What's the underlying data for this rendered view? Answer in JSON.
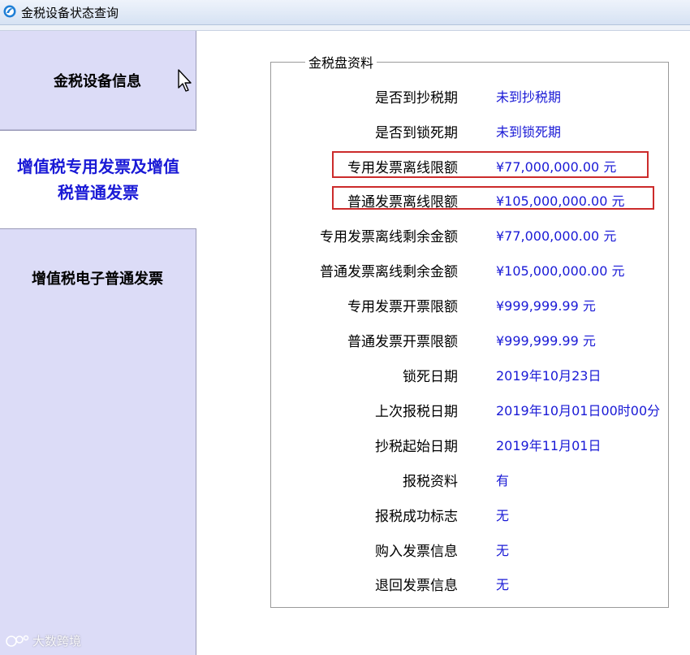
{
  "window": {
    "title": "金税设备状态查询"
  },
  "sidebar": {
    "tabs": [
      {
        "label": "金税设备信息"
      },
      {
        "label": "增值税专用发票及增值税普通发票"
      },
      {
        "label": "增值税电子普通发票"
      }
    ]
  },
  "panel": {
    "legend": "金税盘资料",
    "rows": [
      {
        "label": "是否到抄税期",
        "value": "未到抄税期"
      },
      {
        "label": "是否到锁死期",
        "value": "未到锁死期"
      },
      {
        "label": "专用发票离线限额",
        "value": "¥77,000,000.00 元"
      },
      {
        "label": "普通发票离线限额",
        "value": "¥105,000,000.00 元"
      },
      {
        "label": "专用发票离线剩余金额",
        "value": "¥77,000,000.00 元"
      },
      {
        "label": "普通发票离线剩余金额",
        "value": "¥105,000,000.00 元"
      },
      {
        "label": "专用发票开票限额",
        "value": "¥999,999.99 元"
      },
      {
        "label": "普通发票开票限额",
        "value": "¥999,999.99 元"
      },
      {
        "label": "锁死日期",
        "value": "2019年10月23日"
      },
      {
        "label": "上次报税日期",
        "value": "2019年10月01日00时00分"
      },
      {
        "label": "抄税起始日期",
        "value": "2019年11月01日"
      },
      {
        "label": "报税资料",
        "value": "有"
      },
      {
        "label": "报税成功标志",
        "value": "无"
      },
      {
        "label": "购入发票信息",
        "value": "无"
      },
      {
        "label": "退回发票信息",
        "value": "无"
      }
    ]
  },
  "watermark": {
    "text": "大数跨境"
  },
  "colors": {
    "sidebar": "#dcdcf7",
    "active_tab_text": "#1a1ad6",
    "value_text": "#1a1ad6",
    "highlight": "#cc2b2b"
  }
}
